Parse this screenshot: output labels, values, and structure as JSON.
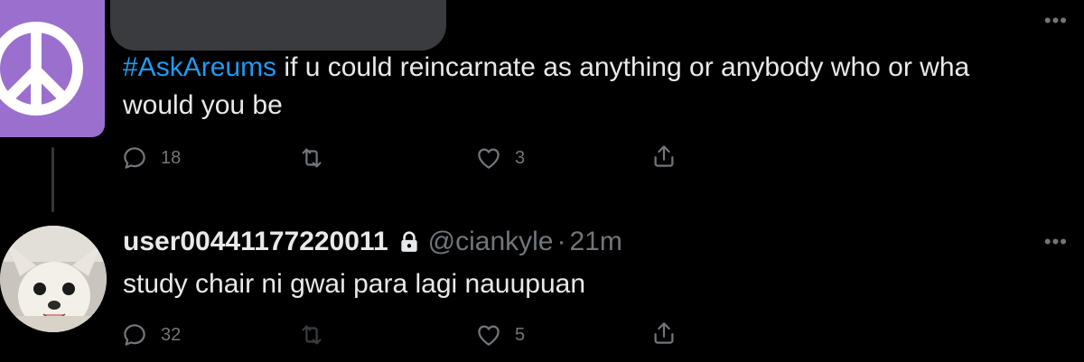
{
  "tweet1": {
    "hashtag": "#AskAreums",
    "text_line1": " if u could reincarnate as anything or anybody who or wha",
    "text_line2": "would you be",
    "replies": "18",
    "retweets": "",
    "likes": "3"
  },
  "tweet2": {
    "username": "user00441177220011",
    "handle": "@ciankyle",
    "separator": "·",
    "time": "21m",
    "text": "study chair ni gwai para lagi nauupuan",
    "replies": "32",
    "retweets": "",
    "likes": "5"
  },
  "icons": {
    "reply": "reply-icon",
    "retweet": "retweet-icon",
    "like": "heart-icon",
    "share": "share-icon",
    "more": "more-icon",
    "lock": "lock-icon"
  },
  "colors": {
    "background": "#000000",
    "text": "#e7e9ea",
    "muted": "#71767b",
    "hashtag": "#1d9bf0",
    "avatar1_bg": "#9b6fce"
  }
}
